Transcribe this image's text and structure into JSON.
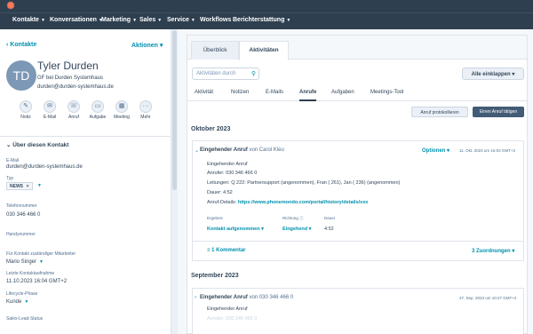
{
  "topbar": {
    "logo_icon": "hubspot-sprocket-icon",
    "logo_glyph": "✺"
  },
  "nav": {
    "items": [
      {
        "label": "Kontakte",
        "has_caret": true
      },
      {
        "label": "Konversationen",
        "has_caret": true
      },
      {
        "label": "Marketing",
        "has_caret": true
      },
      {
        "label": "Sales",
        "has_caret": true
      },
      {
        "label": "Service",
        "has_caret": true
      },
      {
        "label": "Workflows",
        "has_caret": false
      },
      {
        "label": "Berichterstattung",
        "has_caret": true
      }
    ]
  },
  "sidebar": {
    "back_label": "‹ Kontakte",
    "actions_label": "Aktionen ▾",
    "avatar_initials": "TD",
    "name": "Tyler Durden",
    "company": "GF bei Durden Systemhaus",
    "email": "durden@durden-systemhaus.de",
    "action_buttons": [
      {
        "label": "Notiz",
        "icon": "note-icon",
        "glyph": "✎"
      },
      {
        "label": "E-Mail",
        "icon": "email-icon",
        "glyph": "✉"
      },
      {
        "label": "Anruf",
        "icon": "phone-icon",
        "glyph": "☏"
      },
      {
        "label": "Aufgabe",
        "icon": "task-icon",
        "glyph": "▭"
      },
      {
        "label": "Meeting",
        "icon": "calendar-icon",
        "glyph": "▦"
      },
      {
        "label": "Mehr",
        "icon": "more-icon",
        "glyph": "···"
      }
    ],
    "about_heading": "⌄ Über diesen Kontakt",
    "properties": {
      "email_label": "E-Mail",
      "email_value": "durden@durden-systemhaus.de",
      "type_label": "Typ",
      "type_tag": "NEWS",
      "phone_label": "Telefonnummer",
      "phone_value": "030 346 466 0",
      "mobile_label": "Handynummer",
      "owner_label": "Für Kontakt zuständiger Mitarbeiter",
      "owner_value": "Mario Singer",
      "last_contact_label": "Letzte Kontaktaufnahme",
      "last_contact_value": "11.10.2023 16:04 GMT+2",
      "lifecycle_label": "Lifecycle-Phase",
      "lifecycle_value": "Kunde",
      "lead_status_label": "Sales-Lead-Status"
    }
  },
  "main": {
    "tabs": [
      {
        "label": "Überblick",
        "active": false
      },
      {
        "label": "Aktivitäten",
        "active": true
      }
    ],
    "search_placeholder": "Aktivitäten durch",
    "collapse_label": "Alle einklappen ▾",
    "subtabs": [
      {
        "label": "Aktivität",
        "active": false
      },
      {
        "label": "Notizen",
        "active": false
      },
      {
        "label": "E-Mails",
        "active": false
      },
      {
        "label": "Anrufe",
        "active": true
      },
      {
        "label": "Aufgaben",
        "active": false
      },
      {
        "label": "Meetings-Tool",
        "active": false
      }
    ],
    "log_call_label": "Anruf protokollieren",
    "make_call_label": "Einen Anruf tätigen",
    "month_1": "Oktober 2023",
    "month_2": "September 2023",
    "call_1": {
      "title": "Eingehender Anruf",
      "from": " von Carol Kleu",
      "options": "Optionen ▾",
      "date": "11. Okt. 2023 um 16:04 GMT+2",
      "lines": [
        "Eingehender Anruf",
        "Anrufer: 030 346 466 0",
        "Leitungen: Q 222: Partnersupport (angenommen), Fran ( 261), Jan ( 236) (angenommen)",
        "Dauer: 4:52"
      ],
      "details_prefix": "Anruf-Details: ",
      "details_link": "https://www.phonemondo.com/portal/history/details/xxx",
      "result_label": "Ergebnis",
      "result_value": "Kontakt aufgenommen ▾",
      "direction_label": "Richtung ⓘ",
      "direction_value": "Eingehend ▾",
      "duration_label": "Dauer",
      "duration_value": "4:52",
      "comments": "≡ 1 Kommentar",
      "associations": "3 Zuordnungen ▾"
    },
    "call_2": {
      "title": "Eingehender Anruf",
      "from": " von 030 346 466 0",
      "date": "27. Sep. 2023 um 10:27 GMT+2",
      "line": "Eingehender Anruf",
      "faded_line": "Anrufer: 030 346 466 0"
    }
  }
}
